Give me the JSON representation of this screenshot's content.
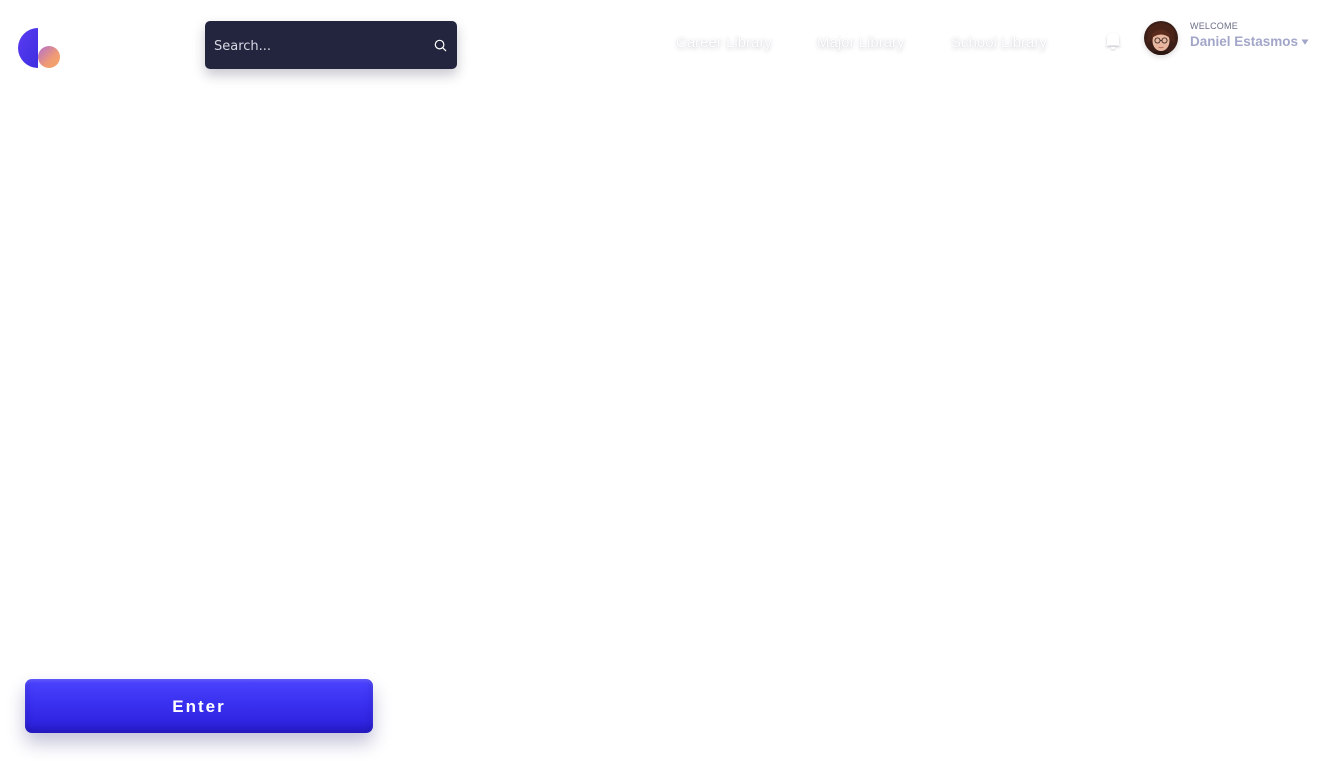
{
  "logo": {
    "icon": "brand-logo-icon",
    "colors": {
      "primary": "#4b3cf0",
      "accent": "#f29a6b"
    }
  },
  "search": {
    "placeholder": "Search...",
    "value": "",
    "icon": "search-icon"
  },
  "nav": {
    "items": [
      {
        "label": "Career Library"
      },
      {
        "label": "Major Library"
      },
      {
        "label": "School Library"
      }
    ]
  },
  "notifications": {
    "icon": "bell-icon"
  },
  "user": {
    "welcome_label": "WELCOME",
    "name": "Daniel Estasmos",
    "menu_icon": "chevron-down-icon"
  },
  "actions": {
    "enter_label": "Enter"
  },
  "colors": {
    "search_bg": "#23253e",
    "button_primary": "#3a30f0",
    "user_name": "#a2a6c8"
  }
}
